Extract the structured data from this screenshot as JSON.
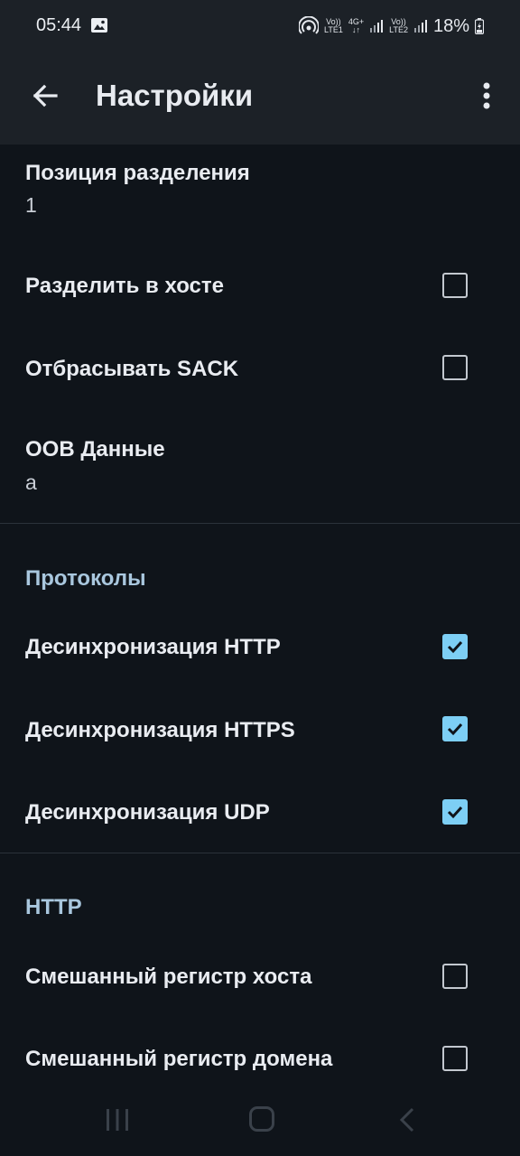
{
  "status_bar": {
    "time": "05:44",
    "sim1_top": "Vo))",
    "sim1_bottom": "LTE1",
    "net": "4G+",
    "sim2_top": "Vo))",
    "sim2_bottom": "LTE2",
    "battery": "18%"
  },
  "app_bar": {
    "title": "Настройки",
    "back_icon": "arrow-back-icon",
    "menu_icon": "more-vert-icon"
  },
  "items": {
    "split_position": {
      "title": "Позиция разделения",
      "summary": "1"
    },
    "split_in_host": {
      "title": "Разделить в хосте",
      "checked": false
    },
    "drop_sack": {
      "title": "Отбрасывать SACK",
      "checked": false
    },
    "oob_data": {
      "title": "OOB Данные",
      "summary": "a"
    }
  },
  "sections": {
    "protocols": "Протоколы",
    "http": "HTTP"
  },
  "protocols": {
    "desync_http": {
      "title": "Десинхронизация HTTP",
      "checked": true
    },
    "desync_https": {
      "title": "Десинхронизация HTTPS",
      "checked": true
    },
    "desync_udp": {
      "title": "Десинхронизация UDP",
      "checked": true
    }
  },
  "http": {
    "mixed_host_case": {
      "title": "Смешанный регистр хоста",
      "checked": false
    },
    "mixed_domain_case": {
      "title": "Смешанный регистр домена",
      "checked": false
    }
  },
  "colors": {
    "background": "#0f141a",
    "app_bar": "#1c2127",
    "accent": "#7dcff5",
    "section_header": "#a9c7de"
  }
}
